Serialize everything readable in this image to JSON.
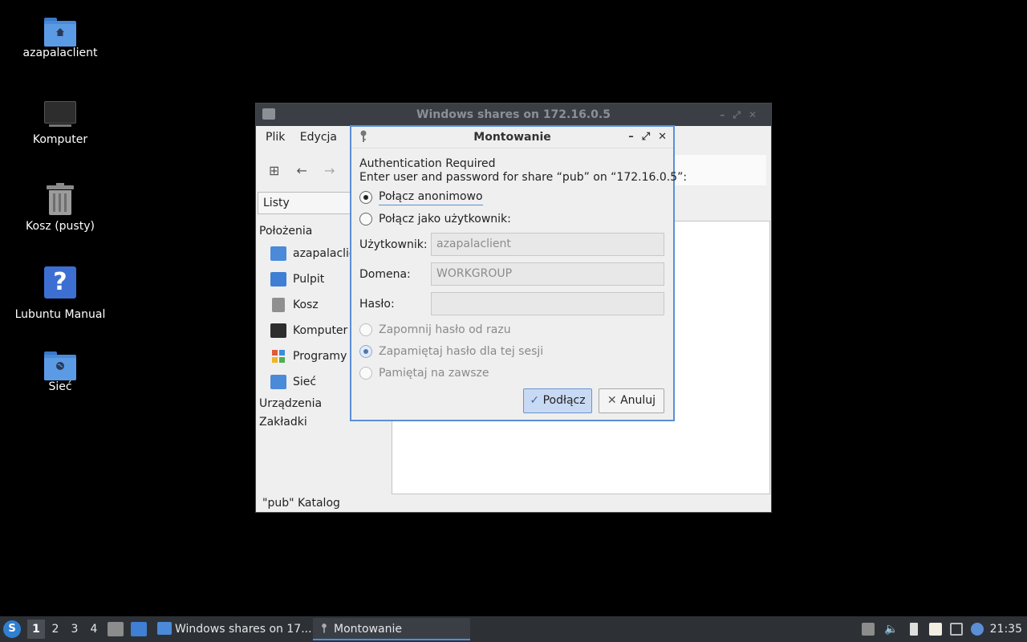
{
  "desktop": {
    "icons": [
      {
        "label": "azapalaclient",
        "icon": "home-folder-icon"
      },
      {
        "label": "Komputer",
        "icon": "computer-icon"
      },
      {
        "label": "Kosz (pusty)",
        "icon": "trash-icon"
      },
      {
        "label": "Lubuntu Manual",
        "icon": "help-icon"
      },
      {
        "label": "Sieć",
        "icon": "network-folder-icon"
      }
    ]
  },
  "file_manager": {
    "title": "Windows shares on 172.16.0.5",
    "menu": [
      "Plik",
      "Edycja"
    ],
    "view_mode": "Listy",
    "sidebar": {
      "places_header": "Położenia",
      "places": [
        {
          "label": "azapalaclient",
          "icon": "home-folder-icon",
          "color": "#4a8ad8"
        },
        {
          "label": "Pulpit",
          "icon": "desktop-icon",
          "color": "#3f7fd4"
        },
        {
          "label": "Kosz",
          "icon": "trash-icon",
          "color": "#8f8f8f"
        },
        {
          "label": "Komputer",
          "icon": "computer-icon",
          "color": "#2d2d2d"
        },
        {
          "label": "Programy",
          "icon": "applications-icon",
          "color": "#e05a3a"
        },
        {
          "label": "Sieć",
          "icon": "network-folder-icon",
          "color": "#4a8ad8"
        }
      ],
      "devices_header": "Urządzenia",
      "bookmarks_header": "Zakładki"
    },
    "status": "\"pub\" Katalog"
  },
  "dialog": {
    "title": "Montowanie",
    "heading": "Authentication Required",
    "message": "Enter user and password for share “pub” on “172.16.0.5”:",
    "connect_anonymous": "Połącz anonimowo",
    "connect_as_user": "Połącz jako użytkownik:",
    "selected_mode": "anonymous",
    "username_label": "Użytkownik:",
    "username_value": "azapalaclient",
    "domain_label": "Domena:",
    "domain_value": "WORKGROUP",
    "password_label": "Hasło:",
    "password_value": "",
    "forget_now": "Zapomnij hasło od razu",
    "remember_session": "Zapamiętaj hasło dla tej sesji",
    "remember_forever": "Pamiętaj na zawsze",
    "selected_remember": "session",
    "connect_button": "Podłącz",
    "cancel_button": "Anuluj"
  },
  "taskbar": {
    "workspaces": [
      "1",
      "2",
      "3",
      "4"
    ],
    "current_workspace": "1",
    "tasks": [
      {
        "label": "Windows shares on 17...",
        "icon": "folder-icon"
      },
      {
        "label": "Montowanie",
        "icon": "key-icon"
      }
    ],
    "clock": "21:35",
    "accent": "#4a90e2"
  }
}
